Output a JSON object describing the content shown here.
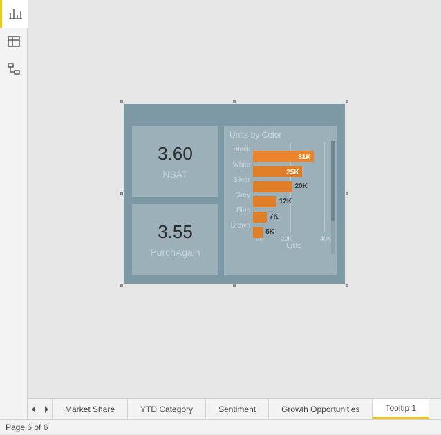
{
  "rail": {
    "items": [
      "report-view",
      "data-view",
      "model-view"
    ],
    "active": 0
  },
  "cards": [
    {
      "value": "3.60",
      "label": "NSAT"
    },
    {
      "value": "3.55",
      "label": "PurchAgain"
    }
  ],
  "chart_data": {
    "type": "bar",
    "title": "Units by Color",
    "xlabel": "Units",
    "xticks": [
      "0K",
      "20K",
      "40K"
    ],
    "xlim": [
      0,
      40000
    ],
    "categories": [
      "Black",
      "White",
      "Silver",
      "Grey",
      "Blue",
      "Brown"
    ],
    "values": [
      31000,
      25000,
      20000,
      12000,
      7000,
      5000
    ],
    "labels": [
      "31K",
      "25K",
      "20K",
      "12K",
      "7K",
      "5K"
    ],
    "highlighted_index": 0
  },
  "tabs": {
    "items": [
      "Market Share",
      "YTD Category",
      "Sentiment",
      "Growth Opportunities",
      "Tooltip 1"
    ],
    "active": 4
  },
  "status": "Page 6 of 6"
}
